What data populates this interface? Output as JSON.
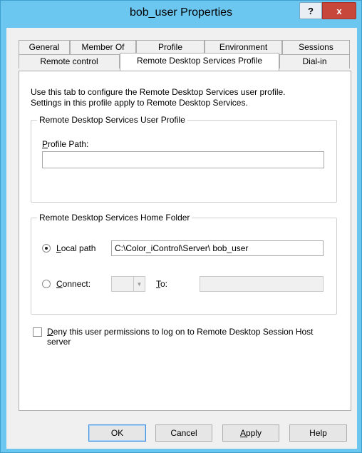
{
  "window": {
    "title": "bob_user Properties",
    "help_label": "?",
    "close_label": "x"
  },
  "tabs_row1": [
    {
      "label": "General"
    },
    {
      "label": "Member Of"
    },
    {
      "label": "Profile"
    },
    {
      "label": "Environment"
    },
    {
      "label": "Sessions"
    }
  ],
  "tabs_row2": [
    {
      "label": "Remote control"
    },
    {
      "label": "Remote Desktop Services Profile",
      "active": true
    },
    {
      "label": "Dial-in"
    }
  ],
  "description_line1": "Use this tab to configure the Remote Desktop Services user profile.",
  "description_line2": "Settings in this profile apply to Remote Desktop Services.",
  "user_profile": {
    "group_title": "Remote Desktop Services User Profile",
    "profile_path_label_accel": "P",
    "profile_path_label_rest": "rofile Path:",
    "profile_path_value": ""
  },
  "home_folder": {
    "group_title": "Remote Desktop Services Home Folder",
    "local_path_accel": "L",
    "local_path_rest": "ocal path",
    "local_path_value": "C:\\Color_iControl\\Server\\ bob_user",
    "local_path_checked": true,
    "connect_accel": "C",
    "connect_rest": "onnect:",
    "connect_checked": false,
    "drive_value": "",
    "to_accel": "T",
    "to_rest": "o:",
    "to_value": ""
  },
  "deny": {
    "accel": "D",
    "line1_rest": "eny this user permissions to log on to Remote Desktop Session Host",
    "line2": "server",
    "checked": false
  },
  "buttons": {
    "ok": "OK",
    "cancel": "Cancel",
    "apply_accel": "A",
    "apply_rest": "pply",
    "help": "Help"
  }
}
